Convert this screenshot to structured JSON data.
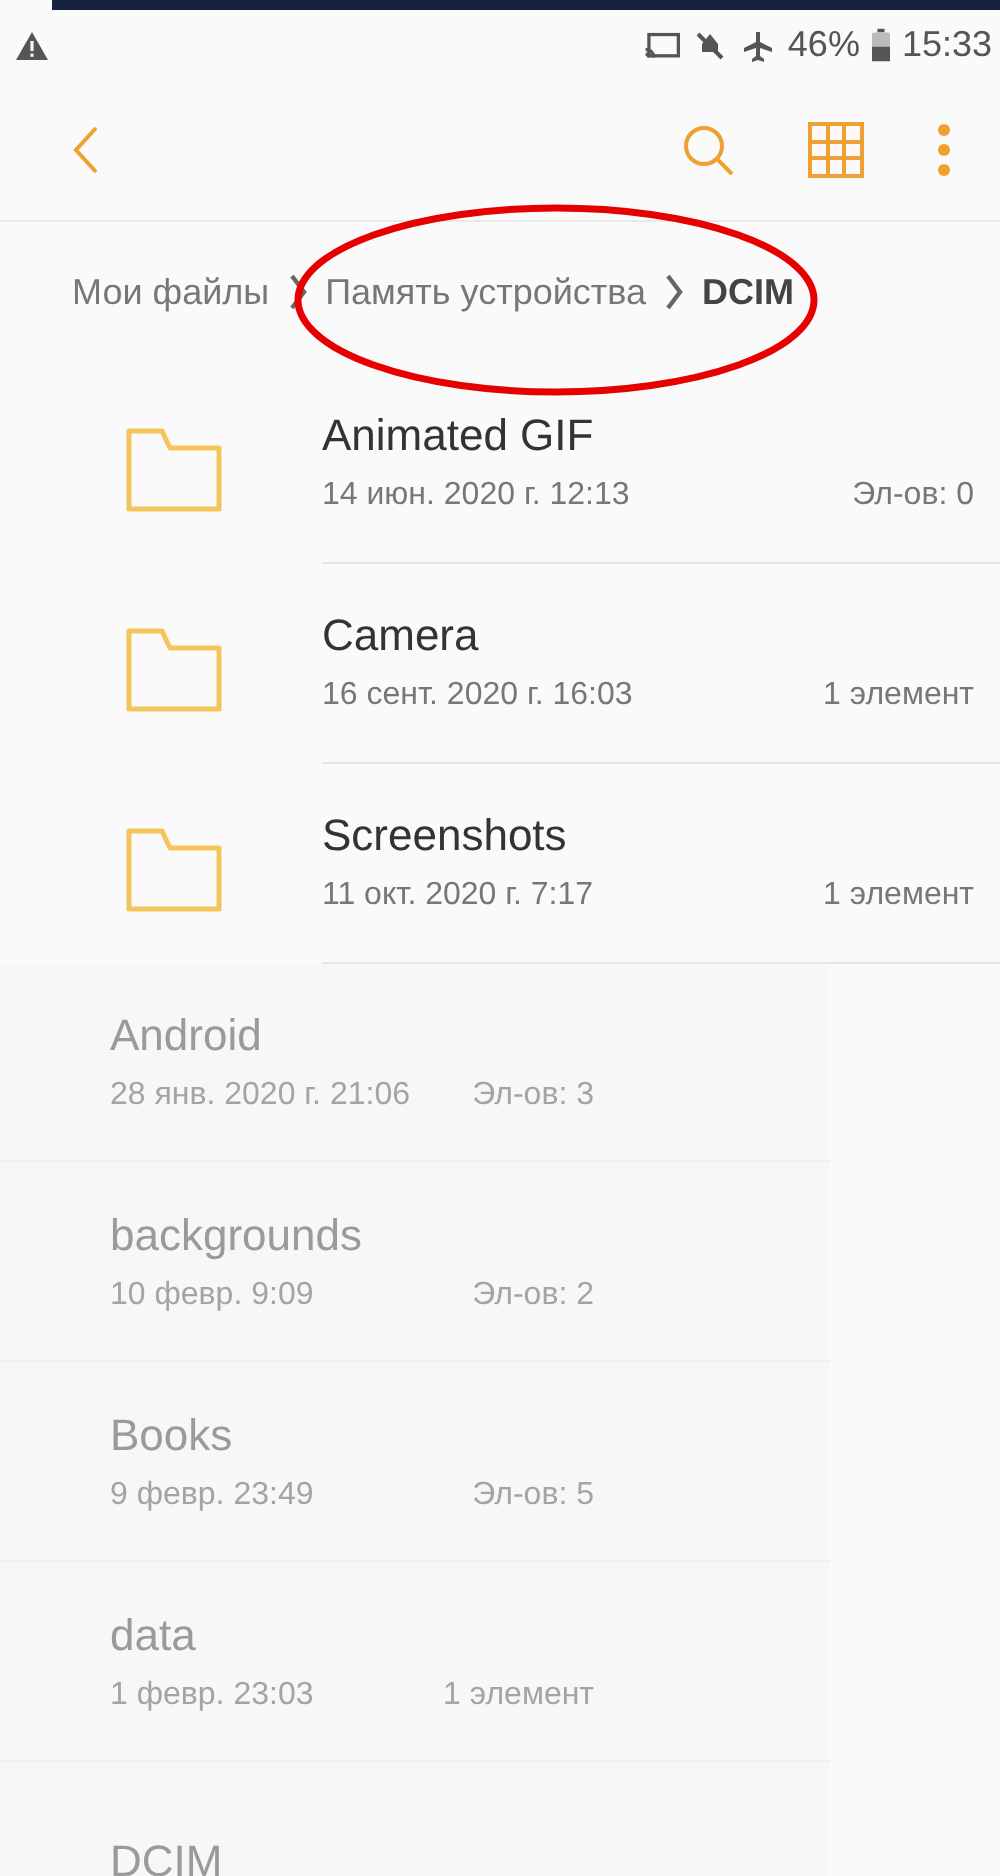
{
  "status_bar": {
    "battery": "46%",
    "time": "15:33"
  },
  "breadcrumb": [
    {
      "label": "Мои файлы",
      "current": false
    },
    {
      "label": "Память устройства",
      "current": false
    },
    {
      "label": "DCIM",
      "current": true
    }
  ],
  "annotation": {
    "kind": "ellipse"
  },
  "folders": [
    {
      "name": "Animated GIF",
      "date": "14 июн. 2020 г. 12:13",
      "count": "Эл-ов: 0"
    },
    {
      "name": "Camera",
      "date": "16 сент. 2020 г. 16:03",
      "count": "1 элемент"
    },
    {
      "name": "Screenshots",
      "date": "11 окт. 2020 г. 7:17",
      "count": "1 элемент"
    }
  ],
  "previous_folders": [
    {
      "name": "Android",
      "date": "28 янв. 2020 г. 21:06",
      "count": "Эл-ов: 3"
    },
    {
      "name": "backgrounds",
      "date": "10 февр. 9:09",
      "count": "Эл-ов: 2"
    },
    {
      "name": "Books",
      "date": "9 февр. 23:49",
      "count": "Эл-ов: 5"
    },
    {
      "name": "data",
      "date": "1 февр. 23:03",
      "count": "1 элемент"
    },
    {
      "name": "DCIM"
    }
  ]
}
